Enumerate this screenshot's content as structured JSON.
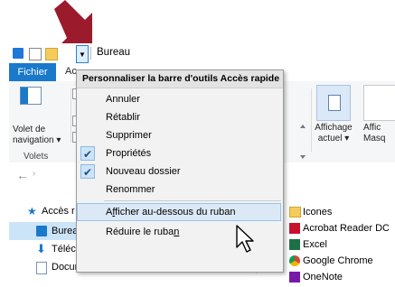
{
  "window": {
    "title": "Bureau"
  },
  "ribbon": {
    "tabs": {
      "fichier": "Fichier",
      "accueil_partial": "Ac"
    },
    "pane": {
      "label_line1": "Volet de",
      "label_line2": "navigation ▾",
      "group": "Volets"
    },
    "view": {
      "label_line1": "Affichage",
      "label_line2": "actuel ▾"
    },
    "options": {
      "label_line1": "Affic",
      "label_line2": "Masq"
    }
  },
  "menu": {
    "header": "Personnaliser la barre d'outils Accès rapide",
    "items": [
      {
        "label": "Annuler",
        "checked": false
      },
      {
        "label": "Rétablir",
        "checked": false
      },
      {
        "label": "Supprimer",
        "checked": false
      },
      {
        "label": "Propriétés",
        "checked": true
      },
      {
        "label": "Nouveau dossier",
        "checked": true
      },
      {
        "label": "Renommer",
        "checked": false
      }
    ],
    "show_below": {
      "before": "A",
      "underline": "f",
      "after": "ficher au-dessous du ruban"
    },
    "minimize": {
      "before": "Réduire le ruba",
      "underline": "n",
      "after": ""
    },
    "check_glyph": "✔"
  },
  "left_nav": {
    "quick_access": "Accès r",
    "items": [
      "Bureau",
      "Téléchargements",
      "Documents"
    ]
  },
  "files": [
    "Icones",
    "Acrobat Reader DC",
    "Excel",
    "Google Chrome",
    "OneNote"
  ],
  "colors": {
    "accent": "#1979ca",
    "arrow": "#9b1b2c",
    "menu_bg": "#f2f2f2",
    "hover_bg": "#dbe9f7"
  }
}
